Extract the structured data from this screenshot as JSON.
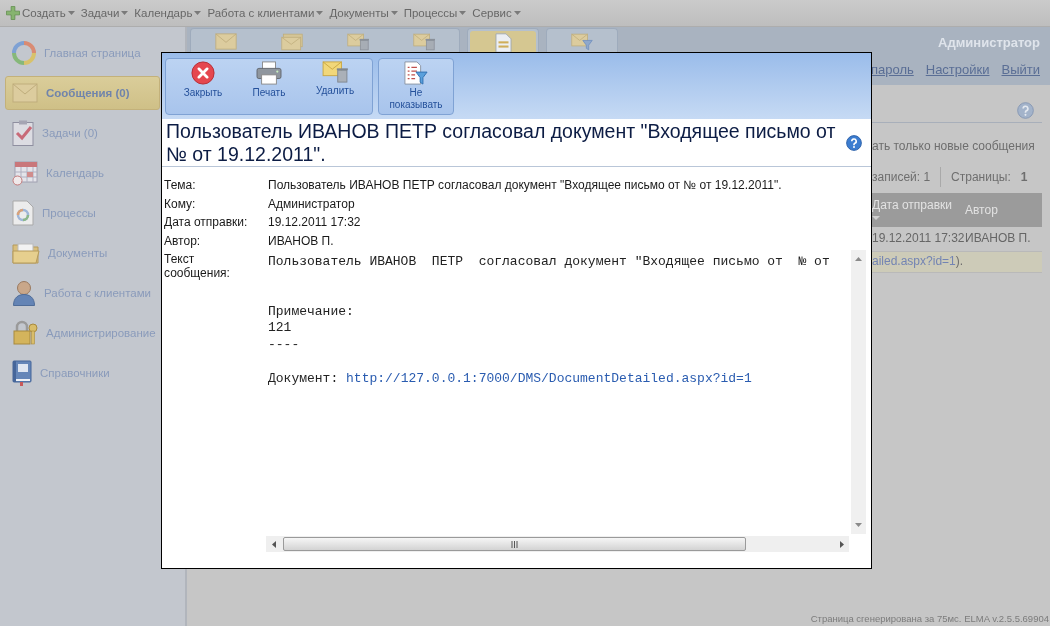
{
  "menu_bar": {
    "create": "Создать",
    "items": [
      "Задачи",
      "Календарь",
      "Работа с клиентами",
      "Документы",
      "Процессы",
      "Сервис"
    ]
  },
  "sidebar": {
    "items": [
      {
        "label": "Главная страница",
        "selected": false
      },
      {
        "label": "Сообщения (0)",
        "selected": true
      },
      {
        "label": "Задачи (0)",
        "selected": false
      },
      {
        "label": "Календарь",
        "selected": false
      },
      {
        "label": "Процессы",
        "selected": false
      },
      {
        "label": "Документы",
        "selected": false
      },
      {
        "label": "Работа с клиентами",
        "selected": false
      },
      {
        "label": "Администрирование",
        "selected": false
      },
      {
        "label": "Справочники",
        "selected": false
      }
    ]
  },
  "ribbon": {
    "groups": [
      {
        "buttons": [
          {
            "selected": false
          },
          {
            "selected": false
          },
          {
            "selected": false
          },
          {
            "selected": false
          }
        ]
      },
      {
        "buttons": [
          {
            "selected": true
          }
        ]
      },
      {
        "buttons": [
          {
            "selected": false
          }
        ]
      }
    ]
  },
  "user_panel": {
    "name": "Администратор",
    "links": [
      "пароль",
      "Настройки",
      "Выйти"
    ]
  },
  "messages_view": {
    "filter_text": "ать только новые сообщения",
    "pager": {
      "records": "записей: 1",
      "pages_label": "Страницы:",
      "page": "1"
    },
    "table": {
      "columns": [
        {
          "label": "Дата отправки",
          "sorted": true
        },
        {
          "label": "Автор",
          "sorted": false
        }
      ],
      "rows": [
        {
          "cells": [
            "19.12.2011 17:32",
            "ИВАНОВ П."
          ]
        }
      ],
      "preview": {
        "link": "ailed.aspx?id=1",
        "tail": ")."
      }
    }
  },
  "dialog": {
    "toolbar": {
      "groups": [
        {
          "buttons": [
            "Закрыть",
            "Печать",
            "Удалить"
          ]
        },
        {
          "buttons": [
            "Не показывать"
          ]
        }
      ]
    },
    "title": "Пользователь ИВАНОВ ПЕТР согласовал документ \"Входящее письмо от № от 19.12.2011\".",
    "fields": [
      {
        "label": "Тема:",
        "value": "Пользователь ИВАНОВ ПЕТР согласовал документ \"Входящее письмо от № от 19.12.2011\"."
      },
      {
        "label": "Кому:",
        "value": "Администратор"
      },
      {
        "label": "Дата отправки:",
        "value": "19.12.2011 17:32"
      },
      {
        "label": "Автор:",
        "value": "ИВАНОВ П."
      }
    ],
    "body": {
      "label": "Текст сообщения:",
      "first_line": "Пользователь ИВАНОВ  ПЕТР  согласовал документ \"Входящее письмо от  № от",
      "note_lines": [
        "Примечание:",
        "121",
        "----"
      ],
      "document_label": "Документ:",
      "document_link": "http://127.0.0.1:7000/DMS/DocumentDetailed.aspx?id=1"
    }
  },
  "footer": "Страница сгенерирована за 75мс. ELMA v.2.5.5.69904"
}
